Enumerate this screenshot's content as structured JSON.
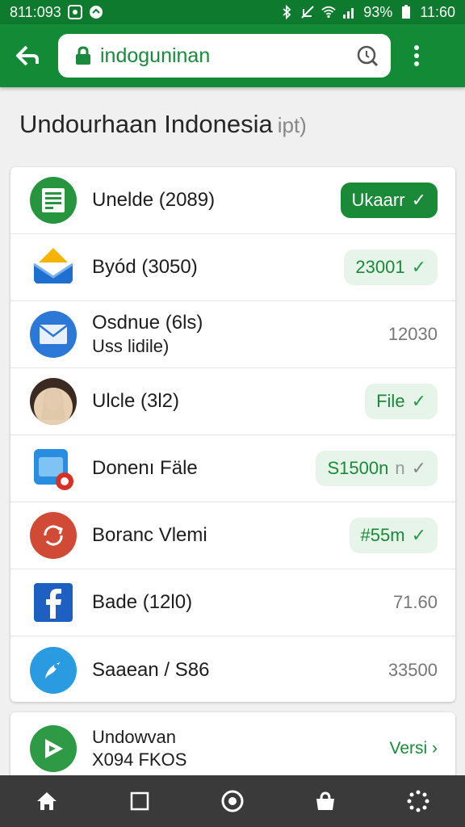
{
  "status_bar": {
    "time_left": "811:093",
    "battery": "93%",
    "time_right": "11:60"
  },
  "toolbar": {
    "url": "indoguninan"
  },
  "page": {
    "title": "Undourhaan Indonesia",
    "title_hint": "ipt)"
  },
  "apps": [
    {
      "name": "Unelde (2089)",
      "action": {
        "text": "Ukaarr",
        "style": "solid",
        "check": true
      },
      "icon": "sheets-icon"
    },
    {
      "name": "Byód (3050)",
      "action": {
        "text": "23001",
        "style": "light",
        "check": true
      },
      "icon": "inbox-icon"
    },
    {
      "name": "Osdnue (6ls)",
      "subtitle": "Uss lidile)",
      "value": "12030",
      "icon": "mail-icon"
    },
    {
      "name": "Ulcle (3l2)",
      "action": {
        "text": "File",
        "style": "light",
        "check": true
      },
      "icon": "avatar"
    },
    {
      "name": "Donenı Fäle",
      "action": {
        "text": "S1500n",
        "extra": "n",
        "style": "light",
        "check": true
      },
      "icon": "calendar-icon"
    },
    {
      "name": "Boranc Vlemi",
      "action": {
        "text": "#55m",
        "style": "light",
        "check": true
      },
      "icon": "sync-icon"
    },
    {
      "name": "Bade (12l0)",
      "value": "71.60",
      "icon": "facebook-icon"
    },
    {
      "name": "Saaean / S86",
      "value": "33500",
      "icon": "browser-icon"
    }
  ],
  "bottom_item": {
    "title": "Undowvan",
    "subtitle": "X094 FKOS",
    "link": "Versi ›",
    "icon": "play-icon"
  },
  "colors": {
    "primary": "#138a36",
    "status": "#0e7a2e",
    "accent": "#1a8a38"
  }
}
